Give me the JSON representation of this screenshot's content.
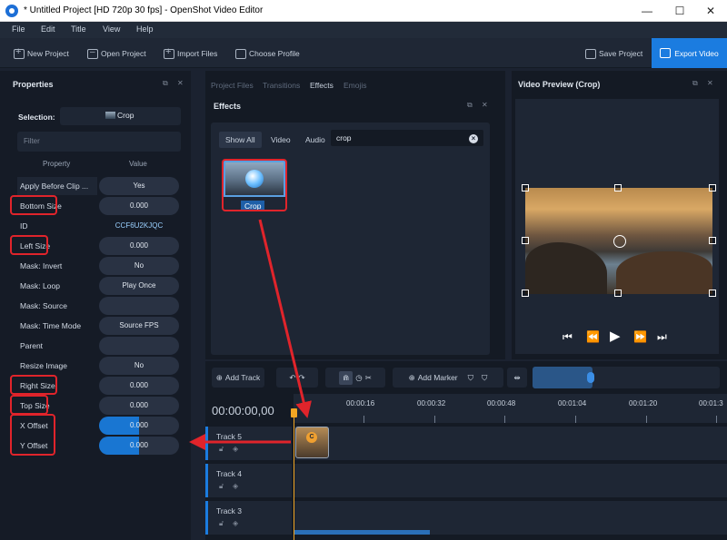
{
  "window": {
    "title": "* Untitled Project [HD 720p 30 fps] - OpenShot Video Editor",
    "min_glyph": "—",
    "max_glyph": "☐",
    "close_glyph": "✕"
  },
  "menu": [
    "File",
    "Edit",
    "Title",
    "View",
    "Help"
  ],
  "toolbar": {
    "new_project": "New Project",
    "open_project": "Open Project",
    "import_files": "Import Files",
    "choose_profile": "Choose Profile",
    "save_project": "Save Project",
    "export_video": "Export Video"
  },
  "dock_icons": {
    "float": "⧉",
    "close": "✕"
  },
  "properties": {
    "title": "Properties",
    "selection_label": "Selection:",
    "selection_value": "Crop",
    "filter_placeholder": "Filter",
    "col_property": "Property",
    "col_value": "Value",
    "rows": [
      {
        "name": "Apply Before Clip ...",
        "value": "Yes"
      },
      {
        "name": "Bottom Size",
        "value": "0.000"
      },
      {
        "name": "ID",
        "value": "CCF6U2KJQC"
      },
      {
        "name": "Left Size",
        "value": "0.000"
      },
      {
        "name": "Mask: Invert",
        "value": "No"
      },
      {
        "name": "Mask: Loop",
        "value": "Play Once"
      },
      {
        "name": "Mask: Source",
        "value": ""
      },
      {
        "name": "Mask: Time Mode",
        "value": "Source FPS"
      },
      {
        "name": "Parent",
        "value": ""
      },
      {
        "name": "Resize Image",
        "value": "No"
      },
      {
        "name": "Right Size",
        "value": "0.000"
      },
      {
        "name": "Top Size",
        "value": "0.000"
      },
      {
        "name": "X Offset",
        "value": "0.000",
        "fill": 0.5
      },
      {
        "name": "Y Offset",
        "value": "0.000",
        "fill": 0.5
      }
    ]
  },
  "center": {
    "tabs": [
      "Project Files",
      "Transitions",
      "Effects",
      "Emojis"
    ],
    "active_tab": "Effects",
    "panel_title": "Effects",
    "filter_tabs": [
      "Show All",
      "Video",
      "Audio"
    ],
    "active_filter": "Show All",
    "search_value": "crop",
    "effect_name": "Crop"
  },
  "preview": {
    "title": "Video Preview (Crop)",
    "controls": {
      "start": "⏮",
      "rewind": "⏪",
      "play": "▶",
      "forward": "⏩",
      "end": "⏭"
    }
  },
  "timeline": {
    "add_track": "Add Track",
    "add_marker": "Add Marker",
    "timecode": "00:00:00,00",
    "ticks": [
      "00:00:16",
      "00:00:32",
      "00:00:48",
      "00:01:04",
      "00:01:20",
      "00:01:3"
    ],
    "tracks": [
      "Track 5",
      "Track 4",
      "Track 3"
    ],
    "clip_badge": "C"
  },
  "colors": {
    "accent": "#1b7ce0",
    "annotation": "#e0242b",
    "playhead": "#f2a623"
  }
}
